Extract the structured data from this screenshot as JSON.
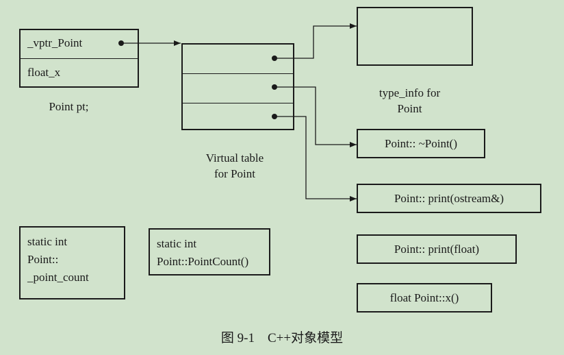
{
  "point_object": {
    "vptr_label": "_vptr_Point",
    "member_label": "float_x",
    "caption": "Point pt;"
  },
  "vtable": {
    "caption_line1": "Virtual table",
    "caption_line2": "for Point"
  },
  "type_info": {
    "caption_line1": "type_info for",
    "caption_line2": "Point"
  },
  "virtual_functions": {
    "destructor": "Point:: ~Point()",
    "print_ostream": "Point:: print(ostream&)"
  },
  "nonvirtual_functions": {
    "print_float": "Point:: print(float)",
    "x_getter": "float Point::x()"
  },
  "static_member": {
    "line1": "static int",
    "line2": "Point::",
    "line3": "_point_count"
  },
  "static_function": {
    "line1": "static int",
    "line2": "Point::PointCount()"
  },
  "figure_caption": "图 9-1    C++对象模型"
}
